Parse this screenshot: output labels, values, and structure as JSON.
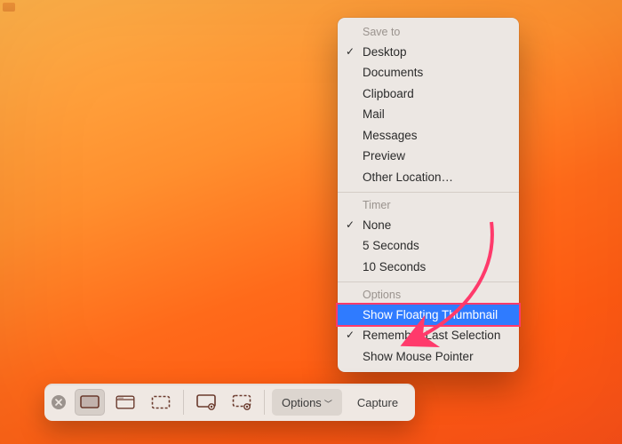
{
  "menu": {
    "sections": {
      "save_to": {
        "title": "Save to",
        "items": [
          {
            "label": "Desktop",
            "checked": true
          },
          {
            "label": "Documents"
          },
          {
            "label": "Clipboard"
          },
          {
            "label": "Mail"
          },
          {
            "label": "Messages"
          },
          {
            "label": "Preview"
          },
          {
            "label": "Other Location…"
          }
        ]
      },
      "timer": {
        "title": "Timer",
        "items": [
          {
            "label": "None",
            "checked": true
          },
          {
            "label": "5 Seconds"
          },
          {
            "label": "10 Seconds"
          }
        ]
      },
      "options": {
        "title": "Options",
        "items": [
          {
            "label": "Show Floating Thumbnail",
            "highlight": true
          },
          {
            "label": "Remember Last Selection",
            "checked": true
          },
          {
            "label": "Show Mouse Pointer"
          }
        ]
      }
    }
  },
  "toolbar": {
    "options_label": "Options",
    "capture_label": "Capture"
  },
  "colors": {
    "highlight_bg": "#2f7bff",
    "annotation": "#ff3a6b"
  }
}
